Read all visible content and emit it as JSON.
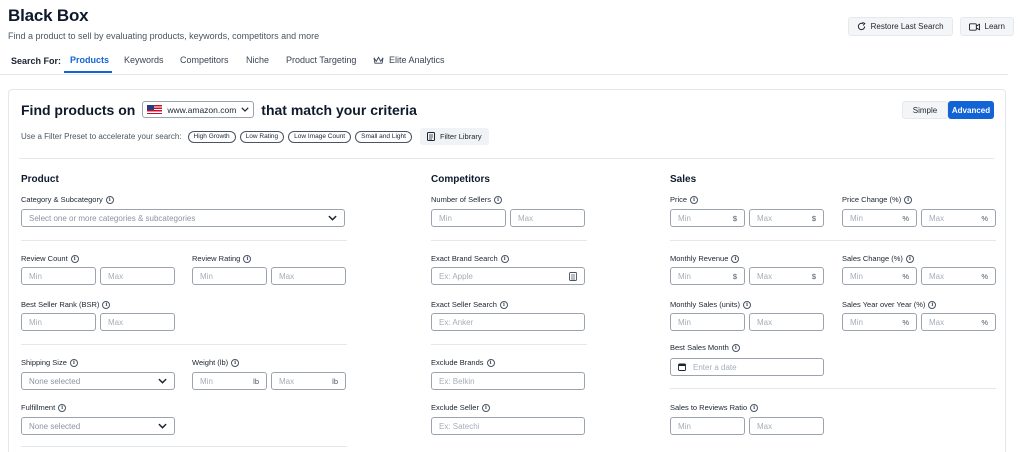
{
  "header": {
    "title": "Black Box",
    "subtitle": "Find a product to sell by evaluating products, keywords, competitors and more"
  },
  "top_actions": {
    "restore": "Restore Last Search",
    "learn": "Learn"
  },
  "tabs": {
    "label": "Search For:",
    "items": [
      "Products",
      "Keywords",
      "Competitors",
      "Niche",
      "Product Targeting",
      "Elite Analytics"
    ],
    "active": "Products"
  },
  "finder": {
    "title_prefix": "Find products on",
    "marketplace": "www.amazon.com",
    "title_suffix": "that match your criteria",
    "mode_simple": "Simple",
    "mode_advanced": "Advanced",
    "preset_label": "Use a Filter Preset to accelerate your search:",
    "presets": [
      "High Growth",
      "Low Rating",
      "Low Image Count",
      "Small and Light"
    ],
    "filter_library": "Filter Library"
  },
  "product": {
    "title": "Product",
    "category_label": "Category & Subcategory",
    "category_placeholder": "Select one or more categories & subcategories",
    "review_count_label": "Review Count",
    "review_rating_label": "Review Rating",
    "bsr_label": "Best Seller Rank (BSR)",
    "shipping_label": "Shipping Size",
    "shipping_placeholder": "None selected",
    "weight_label": "Weight (lb)",
    "weight_unit": "lb",
    "fulfillment_label": "Fulfillment",
    "fulfillment_placeholder": "None selected"
  },
  "competitors": {
    "title": "Competitors",
    "sellers_label": "Number of Sellers",
    "brand_label": "Exact Brand Search",
    "brand_placeholder": "Ex: Apple",
    "seller_label": "Exact Seller Search",
    "seller_placeholder": "Ex: Anker",
    "exclude_brands_label": "Exclude Brands",
    "exclude_brands_placeholder": "Ex: Belkin",
    "exclude_seller_label": "Exclude Seller",
    "exclude_seller_placeholder": "Ex: Satechi"
  },
  "sales": {
    "title": "Sales",
    "price_label": "Price",
    "price_change_label": "Price Change (%)",
    "monthly_revenue_label": "Monthly Revenue",
    "sales_change_label": "Sales Change (%)",
    "monthly_sales_label": "Monthly Sales (units)",
    "sales_yoy_label": "Sales Year over Year (%)",
    "best_month_label": "Best Sales Month",
    "best_month_placeholder": "Enter a date",
    "ratio_label": "Sales to Reviews Ratio",
    "currency": "$",
    "percent": "%"
  },
  "common": {
    "min": "Min",
    "max": "Max",
    "info": "i"
  }
}
